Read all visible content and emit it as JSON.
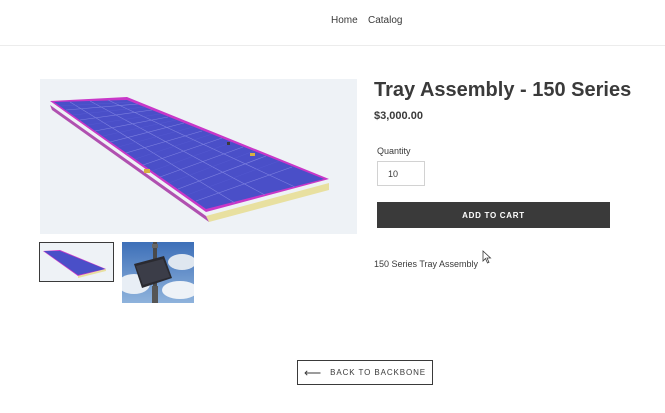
{
  "nav": {
    "home_label": "Home",
    "catalog_label": "Catalog"
  },
  "product": {
    "title": "Tray Assembly - 150 Series",
    "price": "$3,000.00",
    "quantity_label": "Quantity",
    "quantity_value": "10",
    "add_to_cart_label": "ADD TO CART",
    "description": "150 Series Tray Assembly"
  },
  "footer": {
    "back_arrow": "⟵",
    "back_label": "BACK TO BACKBONE"
  },
  "colors": {
    "button_dark": "#3a3a3a",
    "tray_blue": "#4a4fc8",
    "tray_frame": "#c837c8",
    "tray_base": "#e8e0a0"
  }
}
